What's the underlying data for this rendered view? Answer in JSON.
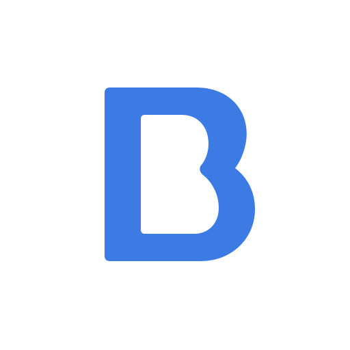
{
  "logo": {
    "icon": "letter-b-logo-icon",
    "letter": "B",
    "color": "#3D7BE4",
    "background": "#FFFFFF"
  }
}
